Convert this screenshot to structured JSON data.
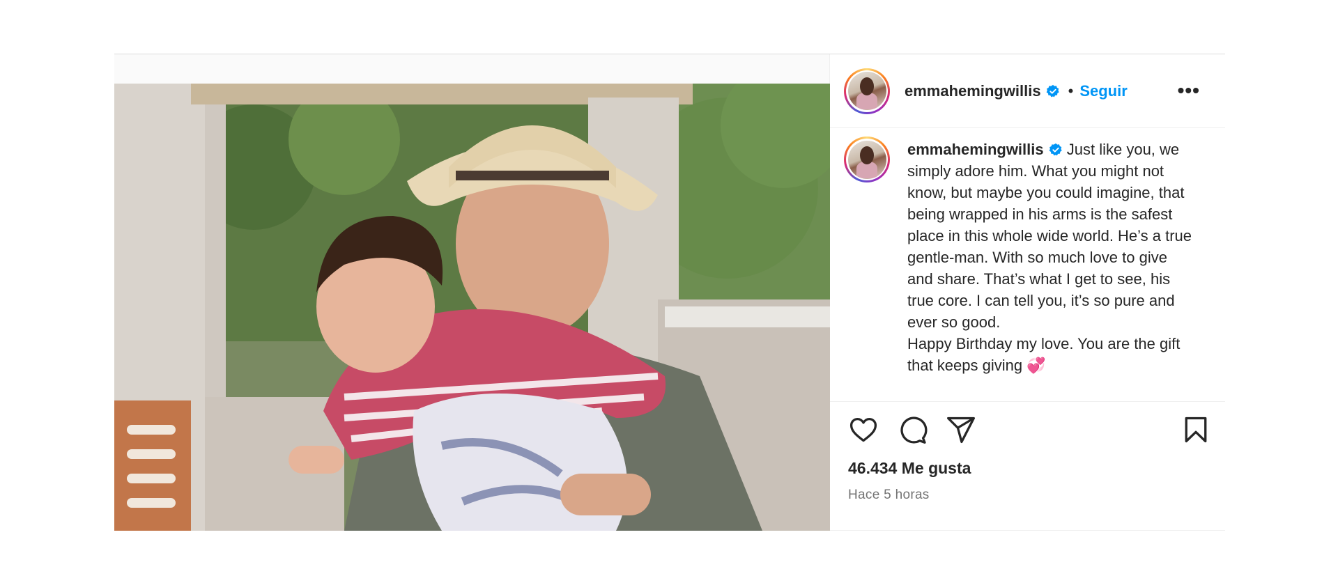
{
  "post": {
    "username": "emmahemingwillis",
    "follow_label": "Seguir",
    "more_label": "•••",
    "caption_username": "emmahemingwillis",
    "caption_body": "Just like you, we simply adore him. What you might not know, but maybe you could imagine, that being wrapped in his arms is the safest place in this whole wide world. He’s a true gentle-man. With so much love to give and share. That’s what I get to see, his true core. I can tell you, it’s so pure and ever so good.",
    "caption_body2": "Happy Birthday my love. You are the gift that keeps giving 💞",
    "likes": "46.434 Me gusta",
    "time": "Hace 5 horas"
  },
  "icons": {
    "verified": "verified-badge-icon",
    "like": "heart-icon",
    "comment": "comment-icon",
    "share": "send-icon",
    "save": "bookmark-icon",
    "more": "more-options-icon"
  },
  "colors": {
    "accent": "#0095f6",
    "verified": "#0095f6",
    "text": "#262626",
    "muted": "#737373"
  }
}
